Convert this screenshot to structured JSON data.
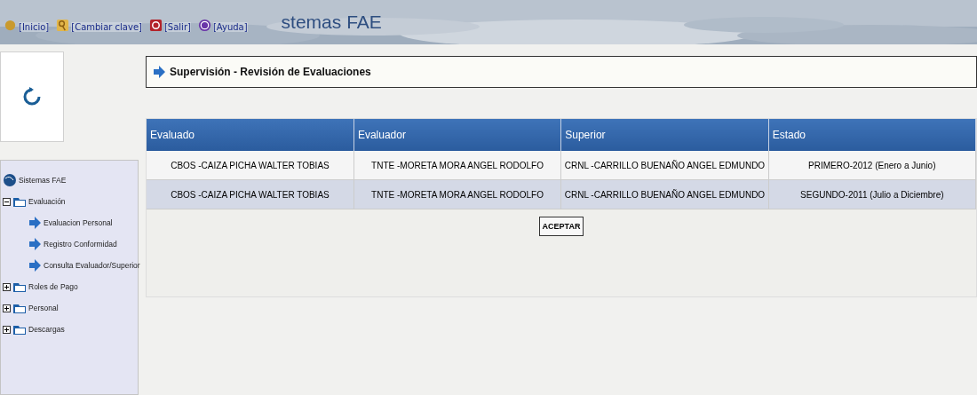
{
  "header": {
    "links": [
      {
        "label": "[Inicio]"
      },
      {
        "label": "[Cambiar clave]"
      },
      {
        "label": "[Salir]"
      },
      {
        "label": "[Ayuda]"
      }
    ],
    "banner_title": "stemas FAE"
  },
  "page_title": "Supervisión - Revisión de Evaluaciones",
  "tree": {
    "label": "Sistemas FAE",
    "children": [
      {
        "label": "Evaluación",
        "expanded": true,
        "children": [
          {
            "label": "Evaluacion Personal"
          },
          {
            "label": "Registro Conformidad"
          },
          {
            "label": "Consulta Evaluador/Superior"
          }
        ]
      },
      {
        "label": "Roles de Pago",
        "expanded": false
      },
      {
        "label": "Personal",
        "expanded": false
      },
      {
        "label": "Descargas",
        "expanded": false
      }
    ]
  },
  "table": {
    "columns": [
      "Evaluado",
      "Evaluador",
      "Superior",
      "Estado"
    ],
    "rows": [
      [
        "CBOS -CAIZA PICHA WALTER TOBIAS",
        "TNTE -MORETA MORA ANGEL RODOLFO",
        "CRNL -CARRILLO BUENAÑO ANGEL EDMUNDO",
        "PRIMERO-2012 (Enero a Junio)"
      ],
      [
        "CBOS -CAIZA PICHA WALTER TOBIAS",
        "TNTE -MORETA MORA ANGEL RODOLFO",
        "CRNL -CARRILLO BUENAÑO ANGEL EDMUNDO",
        "SEGUNDO-2011 (Julio a Diciembre)"
      ]
    ]
  },
  "buttons": [
    "ACEPTAR"
  ]
}
